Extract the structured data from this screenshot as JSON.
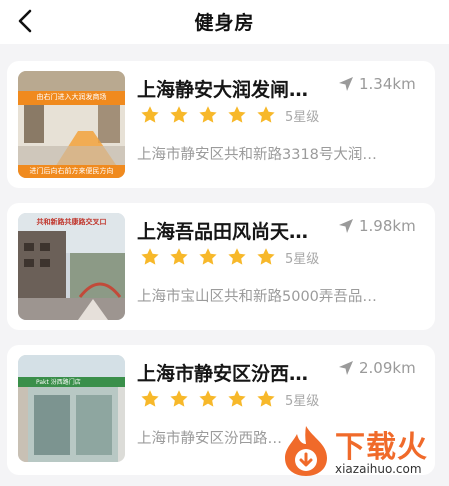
{
  "header": {
    "title": "健身房",
    "back_icon": "chevron-left-icon"
  },
  "cards": [
    {
      "name": "上海静安大润发闸北店",
      "name_display": "上海静安大润发闸…",
      "distance": "1.34km",
      "rating": 5,
      "level": "5星级",
      "address": "上海市静安区共和新路3318号大润…",
      "thumb_top_text": "由右门进入大润发商场",
      "thumb_bottom_text": "进门后向右前方来便民方向"
    },
    {
      "name": "上海吾品田风尚天…",
      "distance": "1.98km",
      "rating": 5,
      "level": "5星级",
      "address": "上海市宝山区共和新路5000弄吾品…",
      "thumb_top_text": "共和新路共康路交叉口"
    },
    {
      "name": "上海市静安区汾西…",
      "distance": "2.09km",
      "rating": 5,
      "level": "5星级",
      "address": "上海市静安区汾西路…",
      "thumb_top_text": "Pakt 汾西路门店"
    }
  ],
  "watermark": {
    "brand": "下载火",
    "url": "xiazaihuo.com"
  },
  "colors": {
    "star": "#f7b82a",
    "accent": "#f06a2a",
    "gray_text": "#9b9b9b"
  }
}
